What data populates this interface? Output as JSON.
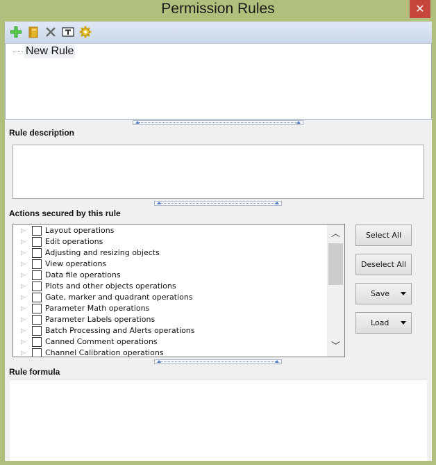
{
  "window": {
    "title": "Permission Rules",
    "close_glyph": "✕"
  },
  "toolbar": {
    "buttons": [
      {
        "name": "add-icon",
        "color": "#2e9c2e"
      },
      {
        "name": "book-icon",
        "color": "#d9a520"
      },
      {
        "name": "delete-icon",
        "color": "#6b6b6b"
      },
      {
        "name": "rename-icon",
        "color": "#2a2a2a"
      },
      {
        "name": "settings-gear-icon",
        "color": "#d8ae16"
      }
    ]
  },
  "rules_tree": {
    "items": [
      "New Rule"
    ]
  },
  "rule_description": {
    "label": "Rule description",
    "value": ""
  },
  "actions": {
    "label": "Actions secured by this rule",
    "items": [
      {
        "label": "Layout operations",
        "checked": false
      },
      {
        "label": "Edit operations",
        "checked": false
      },
      {
        "label": "Adjusting and resizing objects",
        "checked": false
      },
      {
        "label": "View operations",
        "checked": false
      },
      {
        "label": "Data file operations",
        "checked": false
      },
      {
        "label": "Plots and other objects operations",
        "checked": false
      },
      {
        "label": "Gate, marker and quadrant operations",
        "checked": false
      },
      {
        "label": "Parameter Math operations",
        "checked": false
      },
      {
        "label": "Parameter Labels operations",
        "checked": false
      },
      {
        "label": "Batch Processing and Alerts operations",
        "checked": false
      },
      {
        "label": "Canned Comment operations",
        "checked": false
      },
      {
        "label": "Channel Calibration operations",
        "checked": false
      }
    ],
    "select_all_label": "Select All",
    "deselect_all_label": "Deselect All",
    "save_label": "Save",
    "load_label": "Load"
  },
  "rule_formula": {
    "label": "Rule formula",
    "value": ""
  },
  "colors": {
    "frame": "#b0c07c",
    "close": "#c7463b",
    "splitter_arrow": "#4d7cc6"
  }
}
